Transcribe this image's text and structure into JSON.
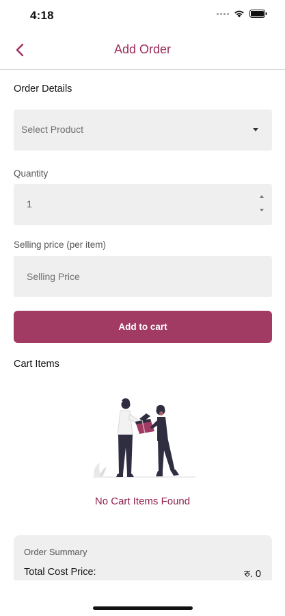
{
  "status_bar": {
    "time": "4:18"
  },
  "header": {
    "title": "Add Order"
  },
  "order_details": {
    "title": "Order Details",
    "product_placeholder": "Select Product",
    "quantity_label": "Quantity",
    "quantity_value": "1",
    "price_label": "Selling price (per item)",
    "price_placeholder": "Selling Price",
    "add_button": "Add to cart"
  },
  "cart": {
    "title": "Cart Items",
    "empty_message": "No Cart Items Found"
  },
  "summary": {
    "title": "Order Summary",
    "total_cost_label": "Total Cost Price:",
    "total_cost_value": "रु. 0"
  },
  "colors": {
    "accent": "#a23b64",
    "accent_text": "#8f1f4d",
    "field_bg": "#efefef"
  }
}
